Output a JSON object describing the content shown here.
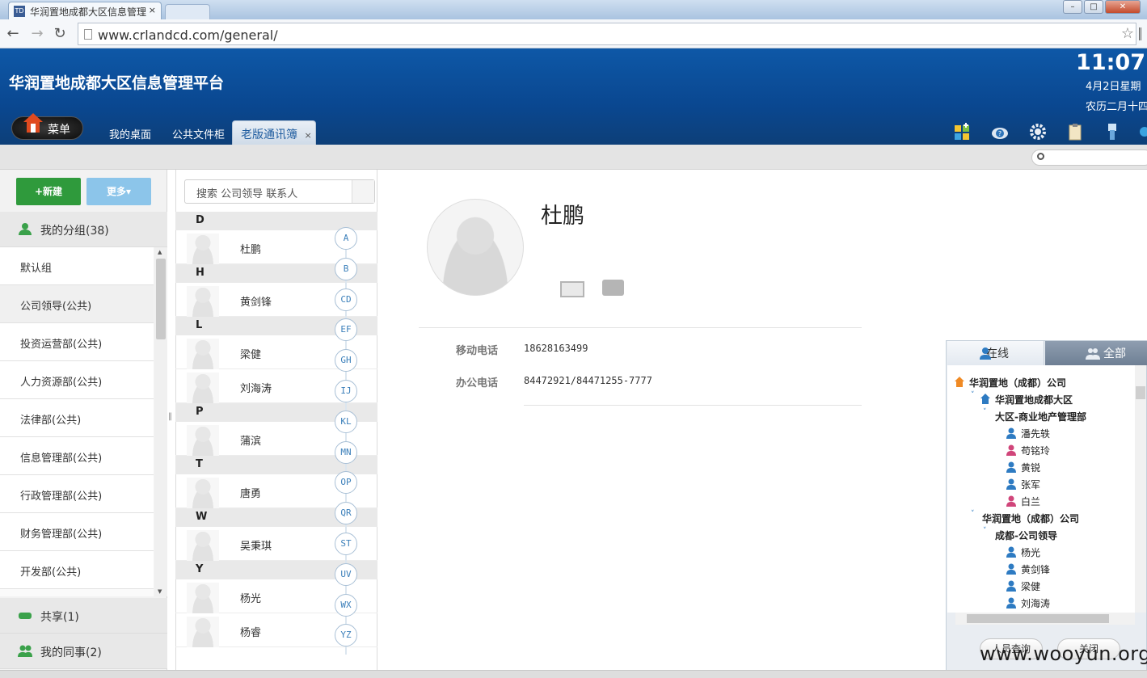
{
  "browser": {
    "tab_title": "华润置地成都大区信息管理",
    "tab_close": "×",
    "favicon_text": "TD",
    "url": "www.crlandcd.com/general/"
  },
  "header": {
    "app_title": "华润置地成都大区信息管理平台",
    "clock": "11:07",
    "date": "4月2日星期",
    "lunar": "农历二月十四",
    "menu_label": "菜单",
    "tabs": [
      {
        "label": "我的桌面"
      },
      {
        "label": "公共文件柜"
      },
      {
        "label": "老版通讯簿",
        "close": "×"
      }
    ]
  },
  "left": {
    "new_label": "新建",
    "more_label": "更多",
    "my_groups": "我的分组(38)",
    "groups": [
      "默认组",
      "公司领导(公共)",
      "投资运营部(公共)",
      "人力资源部(公共)",
      "法律部(公共)",
      "信息管理部(公共)",
      "行政管理部(公共)",
      "财务管理部(公共)",
      "开发部(公共)"
    ],
    "shared": "共享(1)",
    "colleagues": "我的同事(2)"
  },
  "contacts": {
    "search_placeholder": "搜索 公司领导 联系人",
    "sections": [
      {
        "letter": "D",
        "names": [
          "杜鹏"
        ]
      },
      {
        "letter": "H",
        "names": [
          "黄剑锋"
        ]
      },
      {
        "letter": "L",
        "names": [
          "梁健",
          "刘海涛"
        ]
      },
      {
        "letter": "P",
        "names": [
          "蒲滨"
        ]
      },
      {
        "letter": "T",
        "names": [
          "唐勇"
        ]
      },
      {
        "letter": "W",
        "names": [
          "吴秉琪"
        ]
      },
      {
        "letter": "Y",
        "names": [
          "杨光",
          "杨睿"
        ]
      }
    ],
    "index": [
      "A",
      "B",
      "CD",
      "EF",
      "GH",
      "IJ",
      "KL",
      "MN",
      "OP",
      "QR",
      "ST",
      "UV",
      "WX",
      "YZ"
    ]
  },
  "detail": {
    "name": "杜鹏",
    "mobile_label": "移动电话",
    "mobile": "18628163499",
    "office_label": "办公电话",
    "office": "84472921/84471255-7777"
  },
  "online_panel": {
    "tab_online": "在线",
    "tab_all": "全部",
    "tree": {
      "root": "华润置地（成都）公司",
      "region": "华润置地成都大区",
      "dept1": "大区-商业地产管理部",
      "dept1_people": [
        "潘先轶",
        "苟铭玲",
        "黄锐",
        "张军",
        "白兰"
      ],
      "company2": "华润置地（成都）公司",
      "dept2": "成都-公司领导",
      "dept2_people": [
        "杨光",
        "黄剑锋",
        "梁健",
        "刘海涛"
      ]
    },
    "query_button": "人员查询",
    "close_button": "关闭"
  },
  "watermark": "www.wooyun.org",
  "colors": {
    "header_blue": "#0b4a91",
    "new_green": "#2f9a3c",
    "more_blue": "#8cc5ea"
  }
}
